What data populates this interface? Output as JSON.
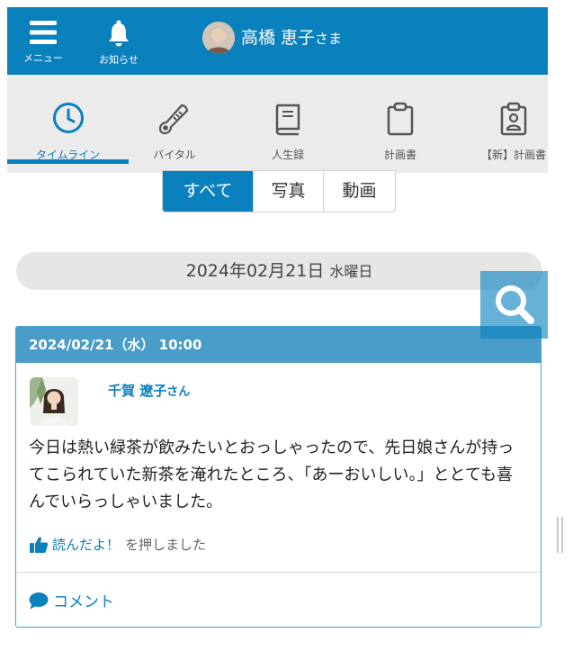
{
  "colors": {
    "brand": "#0a80bd",
    "card_header": "#4a9dc9",
    "tab_bg": "#ebebeb",
    "date_bar": "#e6e6e6"
  },
  "header": {
    "menu_label": "メニュー",
    "menu_icon": "hamburger-icon",
    "notice_label": "お知らせ",
    "notice_icon": "bell-icon",
    "user_name": "高橋 恵子",
    "user_suffix": "さま"
  },
  "tabs": [
    {
      "label": "タイムライン",
      "icon": "clock-icon",
      "active": true
    },
    {
      "label": "バイタル",
      "icon": "thermometer-icon",
      "active": false
    },
    {
      "label": "人生録",
      "icon": "book-icon",
      "active": false
    },
    {
      "label": "計画書",
      "icon": "clipboard-icon",
      "active": false
    },
    {
      "label": "【新】計画書",
      "icon": "clipboard-person-icon",
      "active": false
    }
  ],
  "filters": {
    "all": "すべて",
    "photo": "写真",
    "video": "動画",
    "selected": "すべて"
  },
  "date_header": {
    "date": "2024年02月21日",
    "weekday": "水曜日"
  },
  "search_icon": "search-icon",
  "post": {
    "timestamp": "2024/02/21（水） 10:00",
    "author": "千賀 遼子",
    "author_suffix": "さん",
    "text": "今日は熱い緑茶が飲みたいとおっしゃったので、先日娘さんが持ってこられていた新茶を淹れたところ、「あーおいしい。」ととても喜んでいらっしゃいました。",
    "like_label": "読んだよ！",
    "like_suffix": "を押しました",
    "comment_label": "コメント"
  }
}
